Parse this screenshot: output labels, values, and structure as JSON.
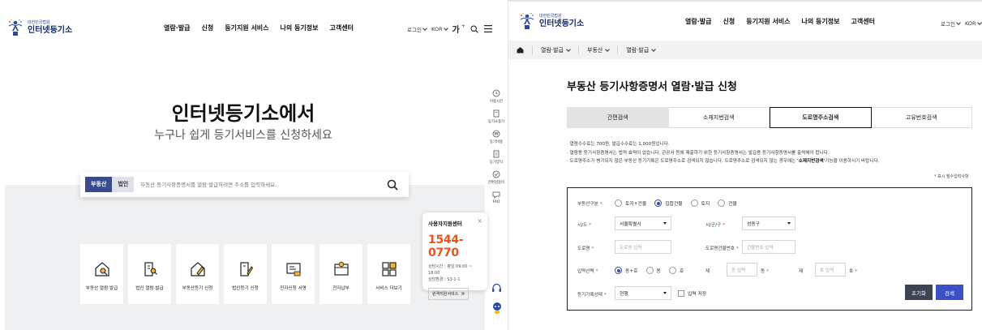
{
  "left": {
    "logo": {
      "top_line": "대한민국법원",
      "name": "인터넷등기소"
    },
    "nav": [
      "열람·발급",
      "신청",
      "등기지원 서비스",
      "나의 등기정보",
      "고객센터"
    ],
    "util": {
      "login": "로그인",
      "lang": "KOR",
      "font_size": "가"
    },
    "hero": {
      "title": "인터넷등기소에서",
      "subtitle": "누구나 쉽게 등기서비스를 신청하세요"
    },
    "search": {
      "seg_active": "부동산",
      "seg_inactive": "법인",
      "placeholder": "부동산 등기사항증명서를 열람·발급하려면 주소를 입력하세요."
    },
    "services": [
      {
        "label": "부동산 열람·발급",
        "icon": "house-search-icon"
      },
      {
        "label": "법인 열람·발급",
        "icon": "building-search-icon"
      },
      {
        "label": "부동산등기 신청",
        "icon": "house-pen-icon"
      },
      {
        "label": "법인등기 신청",
        "icon": "building-pen-icon"
      },
      {
        "label": "전자신청 서명",
        "icon": "sign-document-icon"
      },
      {
        "label": "전자납부",
        "icon": "payment-icon"
      },
      {
        "label": "서비스 더보기",
        "icon": "grid-more-icon"
      }
    ],
    "support": {
      "title": "사용자지원센터",
      "phone": "1544-0770",
      "hours": "상담시간 : 평일 09:00 ~ 18:00",
      "menu": "상담환경 : S3-1-1",
      "link": "원격지원서비스"
    },
    "quickbar": [
      {
        "label": "이용시간",
        "icon": "clock-icon"
      },
      {
        "label": "등기소찾기",
        "icon": "book-icon"
      },
      {
        "label": "등기비용",
        "icon": "coin-icon"
      },
      {
        "label": "등기양식",
        "icon": "form-icon"
      },
      {
        "label": "간편검증이",
        "icon": "check-circle-icon"
      },
      {
        "label": "FAQ",
        "icon": "faq-icon"
      }
    ]
  },
  "right": {
    "logo": {
      "top_line": "대한민국법원",
      "name": "인터넷등기소"
    },
    "nav": [
      "열람·발급",
      "신청",
      "등기지원 서비스",
      "나의 등기정보",
      "고객센터"
    ],
    "util": {
      "login": "로그인",
      "lang": "KOR"
    },
    "breadcrumb": [
      "열람·발급",
      "부동산",
      "열람·발급"
    ],
    "title": "부동산 등기사항증명서 열람·발급 신청",
    "tabs": [
      "간편검색",
      "소재지번검색",
      "도로명주소검색",
      "고유번호검색"
    ],
    "notes": [
      "· 열람수수료는 700원, 발급수수료는 1,000원입니다.",
      "· 열람용 등기사항증명서는 법적 효력이 없습니다. 관공서 등에 제출하기 위한 등기사항증명서는 발급용 등기사항증명서를 출력해야 합니다.",
      "· 도로명주소가 병기되지 않은 부동산 등기기록은 도로명주소로 검색되지 않습니다. 도로명주소로 검색되지 않는 경우에는",
      "'소재지번검색'",
      "기능을 이용하시기 바랍니다."
    ],
    "required_note": "* 표시 필수입력사항",
    "form": {
      "type_label": "부동산구분",
      "type_options": [
        "토지+건물",
        "집합건물",
        "토지",
        "건물"
      ],
      "sido_label": "시/도",
      "sido_value": "서울특별시",
      "sigungu_label": "시/군/구",
      "sigungu_value": "성동구",
      "road_label": "도로명",
      "road_placeholder": "도로명 입력",
      "bldg_no_label": "도로명건물번호",
      "bldg_no_placeholder": "건물번호 입력",
      "input_label": "입력선택",
      "input_options": [
        "동+호",
        "동",
        "호"
      ],
      "je1": "제",
      "dong_placeholder": "동 입력",
      "dong_label": "동",
      "je2": "제",
      "ho_placeholder": "호 입력",
      "ho_label": "호",
      "status_label": "등기기록상태",
      "status_value": "현행",
      "direct_input": "입력 저장",
      "reset_button": "초기화",
      "search_button": "검색"
    }
  }
}
